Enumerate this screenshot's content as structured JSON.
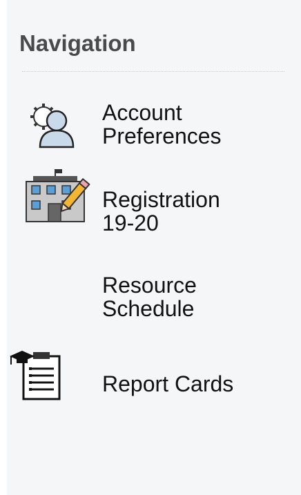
{
  "navigation": {
    "title": "Navigation",
    "items": [
      {
        "label_line1": "Account",
        "label_line2": "Preferences",
        "icon": "account-preferences-icon"
      },
      {
        "label_line1": "Registration",
        "label_line2": "19-20",
        "icon": "registration-icon"
      },
      {
        "label_line1": "Resource",
        "label_line2": "Schedule",
        "icon": ""
      },
      {
        "label_line1": "Report Cards",
        "label_line2": "",
        "icon": "report-cards-icon"
      }
    ]
  }
}
